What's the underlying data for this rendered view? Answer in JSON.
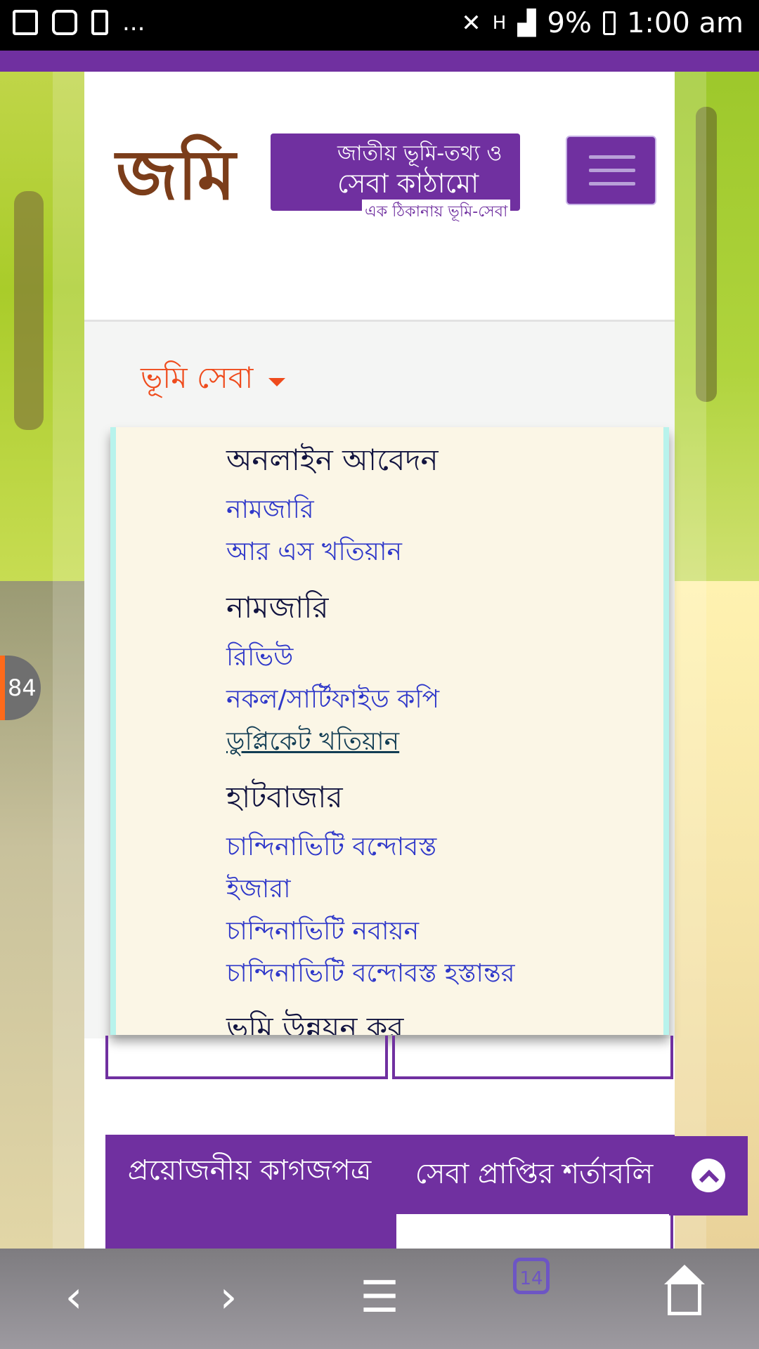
{
  "status_bar": {
    "notifications": [
      "image-icon",
      "camera-icon",
      "alert-icon"
    ],
    "more": "...",
    "network": "H",
    "battery": "9%",
    "time": "1:00 am"
  },
  "header": {
    "logo_main": "জমি",
    "logo_line1": "জাতীয় ভূমি-তথ্য ও",
    "logo_line2": "সেবা কাঠামো",
    "logo_line3": "এক ঠিকানায় ভূমি-সেবা"
  },
  "menu": {
    "toggle_label": "ভূমি সেবা",
    "sections": [
      {
        "heading": "অনলাইন আবেদন",
        "links": [
          "নামজারি",
          "আর এস খতিয়ান"
        ]
      },
      {
        "heading": "নামজারি",
        "links": [
          "রিভিউ",
          "নকল/সার্টিফাইড কপি",
          "ডুপ্লিকেট খতিয়ান"
        ]
      },
      {
        "heading": "হাটবাজার",
        "links": [
          "চান্দিনাভিটি বন্দোবস্ত",
          "ইজারা",
          "চান্দিনাভিটি নবায়ন",
          "চান্দিনাভিটি বন্দোবস্ত হস্তান্তর"
        ]
      },
      {
        "heading": "ভূমি উন্নয়ন কর",
        "links": []
      }
    ]
  },
  "tabs": {
    "required_docs": "প্রয়োজনীয় কাগজপত্র",
    "service_terms": "সেবা প্রাপ্তির শর্তাবলি"
  },
  "side_badge": "84",
  "browser": {
    "tab_count": "14"
  },
  "colors": {
    "brand_purple": "#7030a0",
    "menu_toggle": "#ef4b1c",
    "link_blue": "#2e37c9",
    "dropdown_bg": "#fbf6e6",
    "dropdown_border": "#b8f3ec"
  }
}
